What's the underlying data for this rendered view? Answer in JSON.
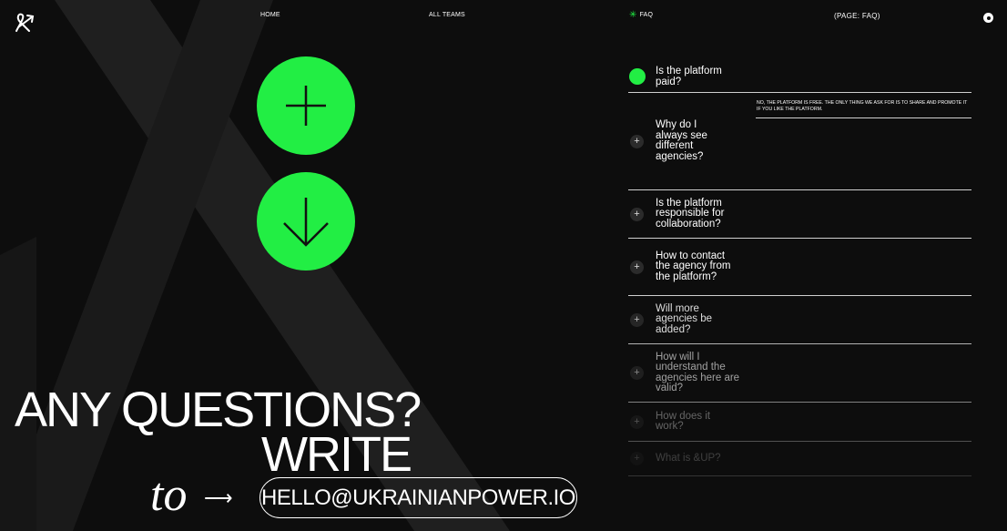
{
  "nav": {
    "home": "HOME",
    "all_teams": "ALL TEAMS",
    "faq": "FAQ",
    "faq_star": "✳",
    "page_label": "(PAGE: FAQ)"
  },
  "colors": {
    "accent": "#22ee44",
    "background": "#0d0d0d",
    "text": "#ffffff"
  },
  "icons": {
    "logo": "ampersand-arrow-logo",
    "plus": "plus-icon",
    "down": "arrow-down-icon"
  },
  "contact": {
    "line1": "ANY QUESTIONS?",
    "line2": "WRITE",
    "to": "to",
    "arrow": "⟶",
    "email": "HELLO@UKRAINIANPOWER.IO"
  },
  "faq": {
    "items": [
      {
        "question": "Is the platform paid?",
        "icon": "+",
        "opacity": 1,
        "open": true
      },
      {
        "question": "Why do I always see different agencies?",
        "icon": "+",
        "opacity": 1
      },
      {
        "question": "Is the platform responsible for collaboration?",
        "icon": "+",
        "opacity": 1
      },
      {
        "question": "How to contact the agency from the platform?",
        "icon": "+",
        "opacity": 1
      },
      {
        "question": "Will more agencies be added?",
        "icon": "+",
        "opacity": 0.85
      },
      {
        "question": "How will I understand the agencies here are valid?",
        "icon": "+",
        "opacity": 0.6
      },
      {
        "question": "How does it work?",
        "icon": "+",
        "opacity": 0.35
      },
      {
        "question": "What is &UP?",
        "icon": "+",
        "opacity": 0.2
      }
    ],
    "answer": "NO, THE PLATFORM IS FREE. THE ONLY THING WE ASK FOR IS TO SHARE AND PROMOTE IT IF YOU LIKE THE PLATFORM."
  }
}
